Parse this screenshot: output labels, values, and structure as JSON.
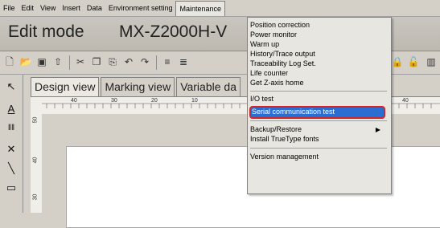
{
  "menubar": {
    "items": [
      "File",
      "Edit",
      "View",
      "Insert",
      "Data",
      "Environment setting",
      "Maintenance"
    ]
  },
  "header": {
    "mode_label": "Edit mode",
    "model": "MX-Z2000H-V"
  },
  "tabs": [
    "Design view",
    "Marking view",
    "Variable da"
  ],
  "ruler_h": [
    "40",
    "30",
    "20",
    "10",
    "40"
  ],
  "ruler_v": [
    "50",
    "40",
    "30"
  ],
  "maintenance_menu": {
    "items": [
      "Position correction",
      "Power monitor",
      "Warm up",
      "History/Trace output",
      "Traceability Log Set.",
      "Life counter",
      "Get Z-axis home",
      "I/O test",
      "Serial communication test",
      "Backup/Restore",
      "Install TrueType fonts",
      "Version management"
    ],
    "submenu_arrow": "▶"
  },
  "colors": {
    "highlight_bg": "#2b6ed1",
    "highlight_border": "#d3242b"
  }
}
